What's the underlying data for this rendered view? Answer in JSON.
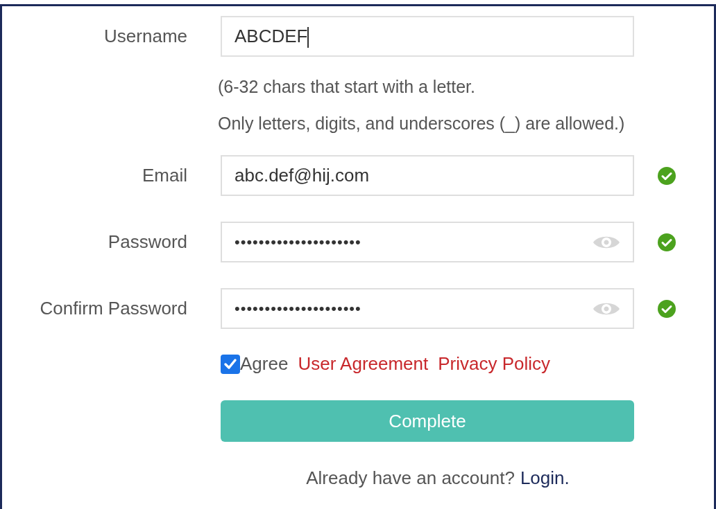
{
  "fields": [
    {
      "label": "Username",
      "kind": "text",
      "value": "ABCDEF",
      "focused": true,
      "valid": false,
      "hints": [
        "(6-32 chars that start with a letter.",
        "Only letters, digits, and underscores (_) are allowed.)"
      ]
    },
    {
      "label": "Email",
      "kind": "text",
      "value": "abc.def@hij.com",
      "focused": false,
      "valid": true
    },
    {
      "label": "Password",
      "kind": "password",
      "value": "•••••••••••••••••••••",
      "focused": false,
      "valid": true
    },
    {
      "label": "Confirm Password",
      "kind": "password",
      "value": "•••••••••••••••••••••",
      "focused": false,
      "valid": true
    }
  ],
  "agreement": {
    "checked": true,
    "label": "Agree",
    "links": [
      "User Agreement",
      "Privacy Policy"
    ]
  },
  "submit": "Complete",
  "login_prompt": {
    "text": "Already have an account?",
    "link": "Login."
  }
}
